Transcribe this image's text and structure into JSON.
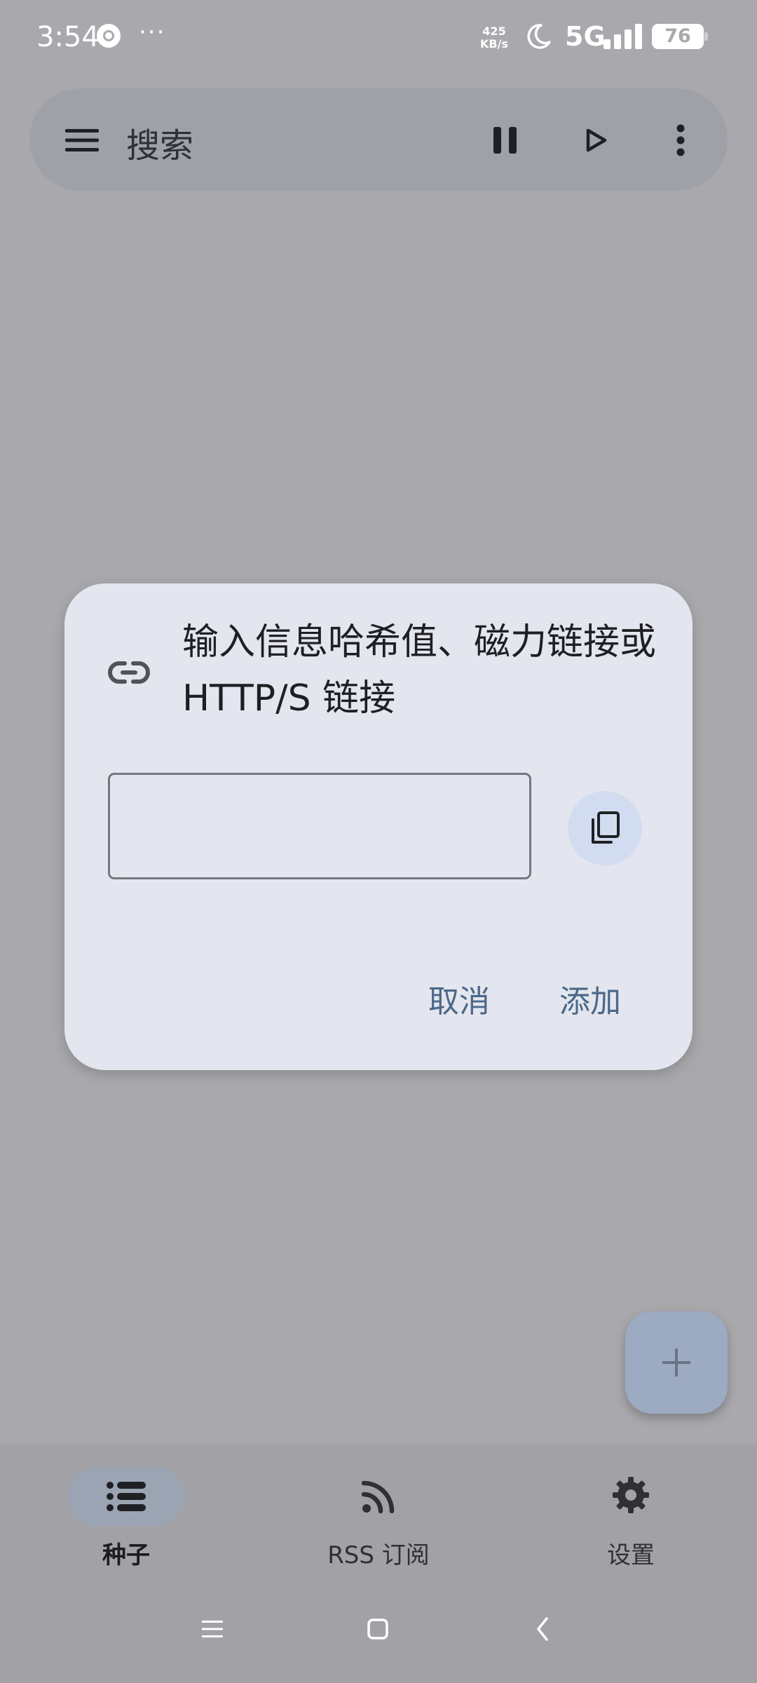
{
  "status_bar": {
    "time": "3:54",
    "more": "···",
    "net_speed_value": "425",
    "net_speed_unit": "KB/s",
    "network": "5G",
    "battery": "76"
  },
  "top_bar": {
    "search_placeholder": "搜索",
    "icons": [
      "menu-icon",
      "pause-icon",
      "play-icon",
      "more-vert-icon"
    ]
  },
  "dialog": {
    "title": "输入信息哈希值、磁力链接或 HTTP/S 链接",
    "input_value": "",
    "cancel_label": "取消",
    "add_label": "添加"
  },
  "bottom_nav": {
    "items": [
      {
        "label": "种子",
        "icon": "list-icon",
        "selected": true
      },
      {
        "label": "RSS 订阅",
        "icon": "rss-icon",
        "selected": false
      },
      {
        "label": "设置",
        "icon": "gear-icon",
        "selected": false
      }
    ]
  },
  "colors": {
    "scrim_background": "#a9a9ad",
    "dialog_background": "#e3e6ee",
    "accent_text": "#4c6889",
    "fab_background": "#9caac2",
    "nav_selected_pill": "#9ba4b3"
  }
}
